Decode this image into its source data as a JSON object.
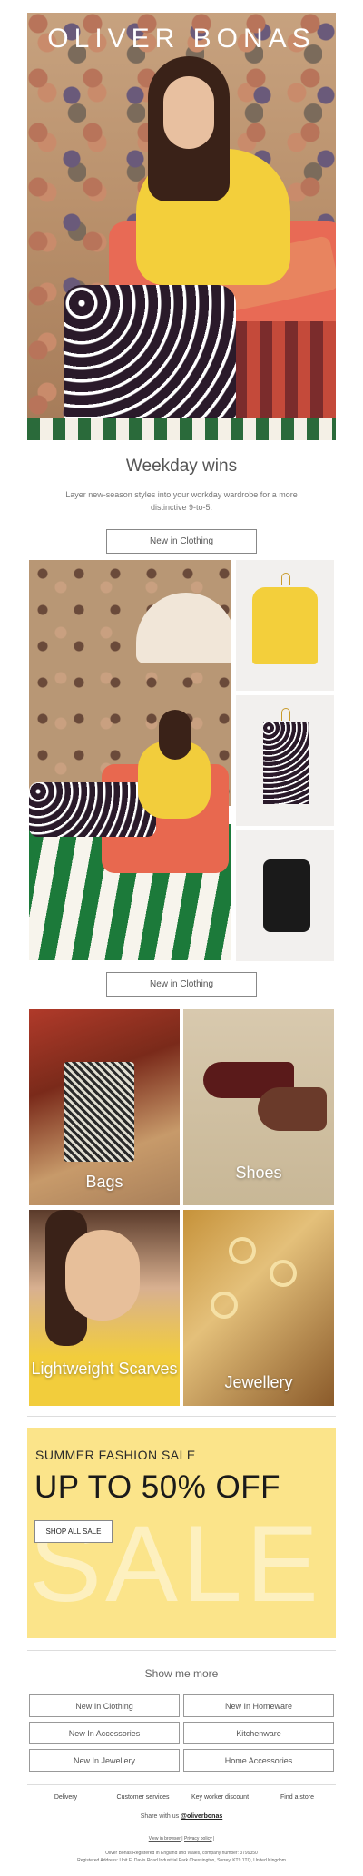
{
  "brand": {
    "logo_text": "OLIVER BONAS"
  },
  "hero": {
    "headline": "Weekday wins",
    "subtext": "Layer new-season styles into your workday wardrobe for a more distinctive 9-to-5.",
    "cta": "New in Clothing"
  },
  "grid": {
    "cta": "New in Clothing"
  },
  "categories": [
    {
      "label": "Bags"
    },
    {
      "label": "Shoes"
    },
    {
      "label": "Lightweight Scarves"
    },
    {
      "label": "Jewellery"
    }
  ],
  "sale": {
    "eyebrow": "SUMMER FASHION SALE",
    "headline": "UP TO 50% OFF",
    "cta": "SHOP ALL SALE",
    "watermark": "SALE"
  },
  "more": {
    "title": "Show me more",
    "links": [
      "New In Clothing",
      "New In Homeware",
      "New In Accessories",
      "Kitchenware",
      "New In Jewellery",
      "Home Accessories"
    ]
  },
  "footer": {
    "links": [
      "Delivery",
      "Customer services",
      "Key worker discount",
      "Find a store"
    ],
    "share_prefix": "Share with us",
    "share_handle": "@oliverbonas",
    "view_in_browser": "View in browser",
    "privacy_policy": "Privacy policy",
    "legal_line1": "Oliver Bonas Registered in England and Wales, company number: 3799350",
    "legal_line2": "Registered Address: Unit E, Davis Road Industrial Park Chessington, Surrey, KT9 1TQ, United Kingdom"
  }
}
